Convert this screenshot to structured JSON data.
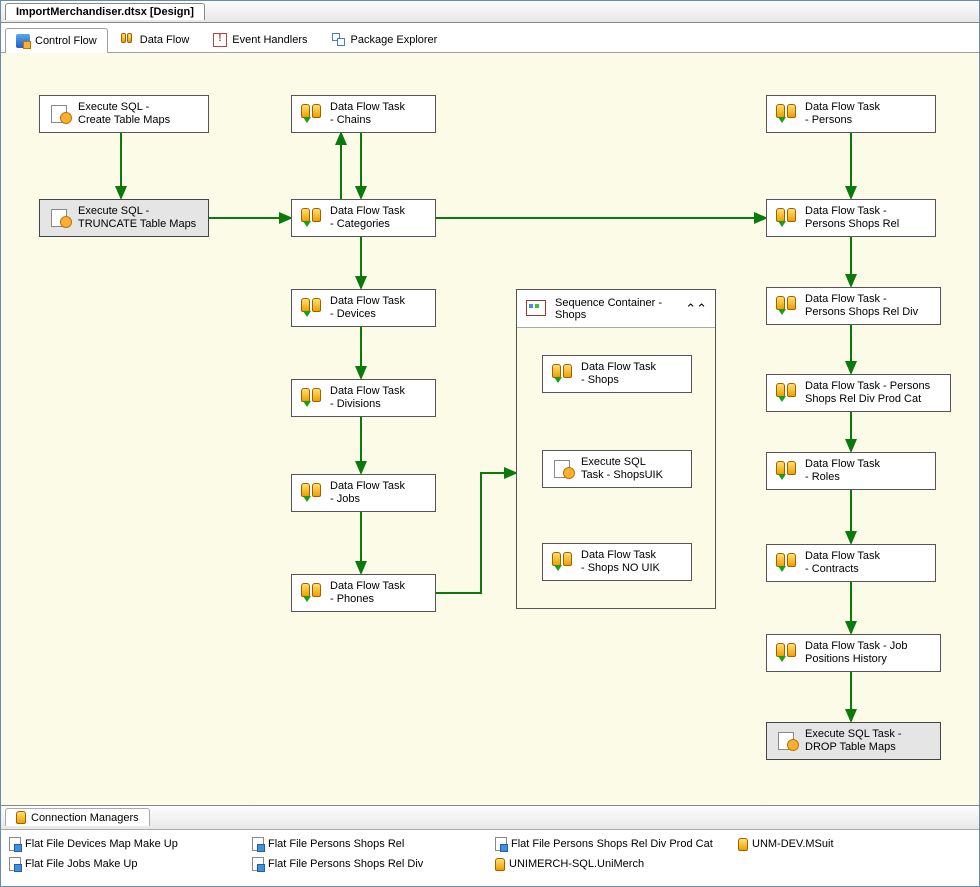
{
  "document_tab": "ImportMerchandiser.dtsx [Design]",
  "tabs": {
    "control_flow": "Control Flow",
    "data_flow": "Data Flow",
    "event_handlers": "Event Handlers",
    "package_explorer": "Package Explorer"
  },
  "tasks": {
    "create_maps": "Execute SQL -\nCreate Table Maps",
    "truncate_maps": "Execute SQL -\nTRUNCATE Table Maps",
    "chains": "Data Flow Task\n- Chains",
    "categories": "Data Flow Task\n- Categories",
    "devices": "Data Flow Task\n- Devices",
    "divisions": "Data Flow Task\n- Divisions",
    "jobs": "Data Flow Task\n- Jobs",
    "phones": "Data Flow Task\n- Phones",
    "seq_header": "Sequence Container\n- Shops",
    "shops": "Data Flow Task\n- Shops",
    "shops_uik": "Execute SQL\nTask - ShopsUIK",
    "shops_no_uik": "Data Flow Task\n- Shops NO UIK",
    "persons": "Data Flow Task\n- Persons",
    "persons_shops_rel": "Data Flow Task -\nPersons Shops Rel",
    "persons_shops_rel_div": "Data Flow Task -\nPersons Shops Rel Div",
    "persons_shops_rel_div_prod_cat": "Data Flow Task - Persons\nShops Rel Div Prod Cat",
    "roles": "Data Flow Task\n- Roles",
    "contracts": "Data Flow Task\n- Contracts",
    "job_positions": "Data Flow Task - Job\nPositions History",
    "drop_maps": "Execute SQL Task -\nDROP Table Maps"
  },
  "connection_managers": {
    "title": "Connection Managers",
    "items": [
      {
        "name": "Flat File Devices Map Make Up",
        "type": "file"
      },
      {
        "name": "Flat File Jobs Make Up",
        "type": "file"
      },
      {
        "name": "Flat File Persons Shops Rel",
        "type": "file"
      },
      {
        "name": "Flat File Persons Shops Rel Div",
        "type": "file"
      },
      {
        "name": "Flat File Persons Shops Rel Div Prod Cat",
        "type": "file"
      },
      {
        "name": "UNIMERCH-SQL.UniMerch",
        "type": "db"
      },
      {
        "name": "UNM-DEV.MSuit",
        "type": "db"
      }
    ]
  }
}
